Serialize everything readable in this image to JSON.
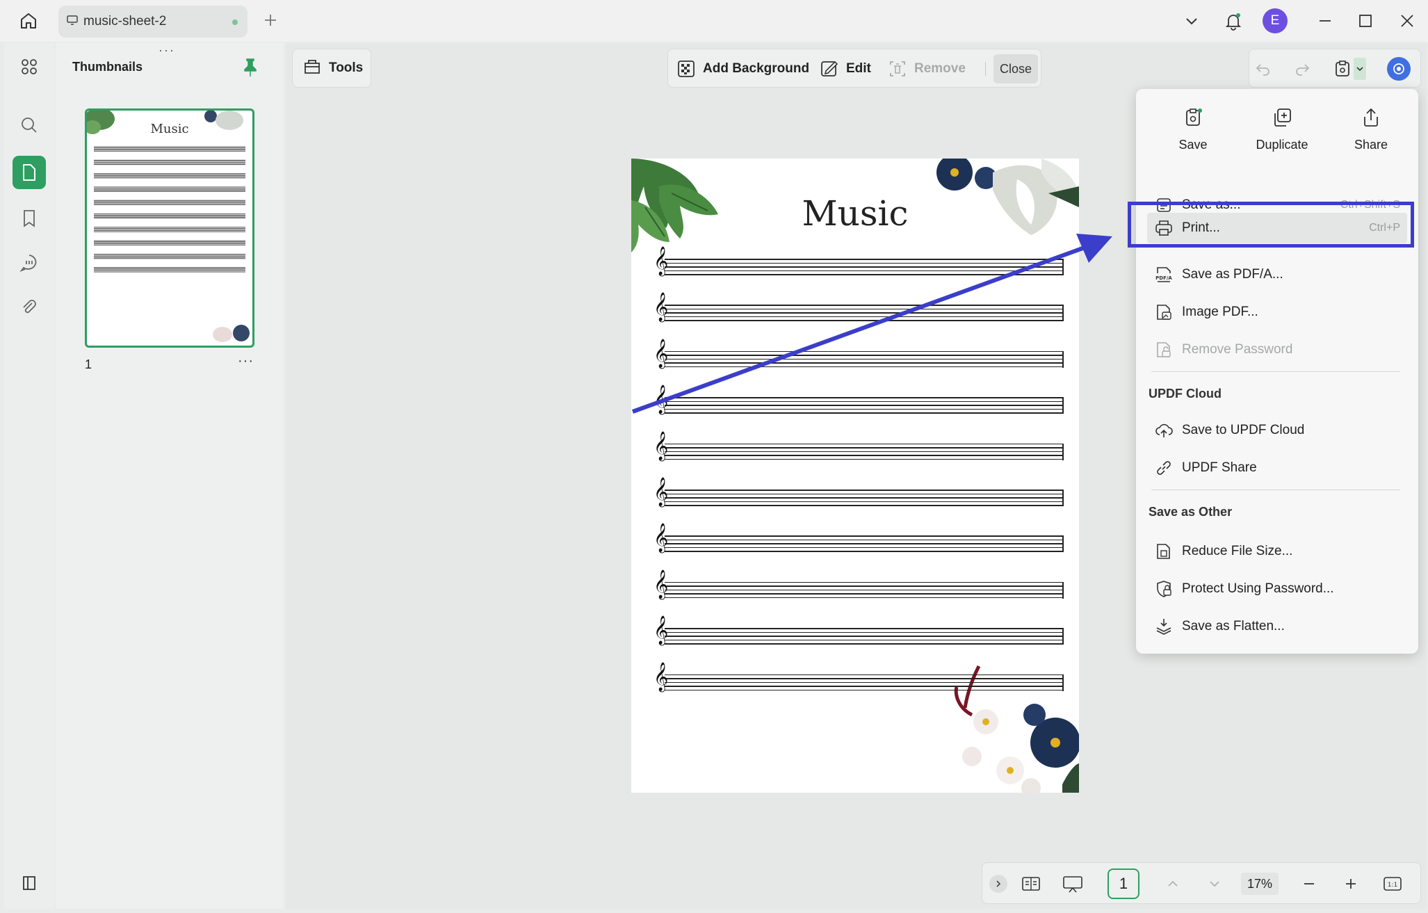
{
  "tab": {
    "title": "music-sheet-2"
  },
  "user": {
    "initial": "E"
  },
  "thumbnails": {
    "title": "Thumbnails",
    "page_number": "1",
    "thumb_title": "Music"
  },
  "toolbar": {
    "tools": "Tools",
    "add_background": "Add Background",
    "edit": "Edit",
    "remove": "Remove",
    "close": "Close"
  },
  "page": {
    "title": "Music",
    "staff_count": 10
  },
  "bottom": {
    "page": "1",
    "zoom": "17%",
    "fit": "1:1"
  },
  "menu": {
    "top": [
      {
        "label": "Save",
        "icon": "save-icon"
      },
      {
        "label": "Duplicate",
        "icon": "duplicate-icon"
      },
      {
        "label": "Share",
        "icon": "share-icon"
      }
    ],
    "save_as": {
      "label": "Save as...",
      "shortcut": "Ctrl+Shift+S"
    },
    "print": {
      "label": "Print...",
      "shortcut": "Ctrl+P"
    },
    "save_pdfa": "Save as PDF/A...",
    "image_pdf": "Image PDF...",
    "remove_password": "Remove Password",
    "cloud_section": "UPDF Cloud",
    "save_cloud": "Save to UPDF Cloud",
    "updf_share": "UPDF Share",
    "other_section": "Save as Other",
    "reduce": "Reduce File Size...",
    "protect": "Protect Using Password...",
    "flatten": "Save as Flatten..."
  },
  "colors": {
    "accent": "#2e9e61",
    "highlight": "#3b3ec9",
    "avatar": "#6d4fe0"
  }
}
